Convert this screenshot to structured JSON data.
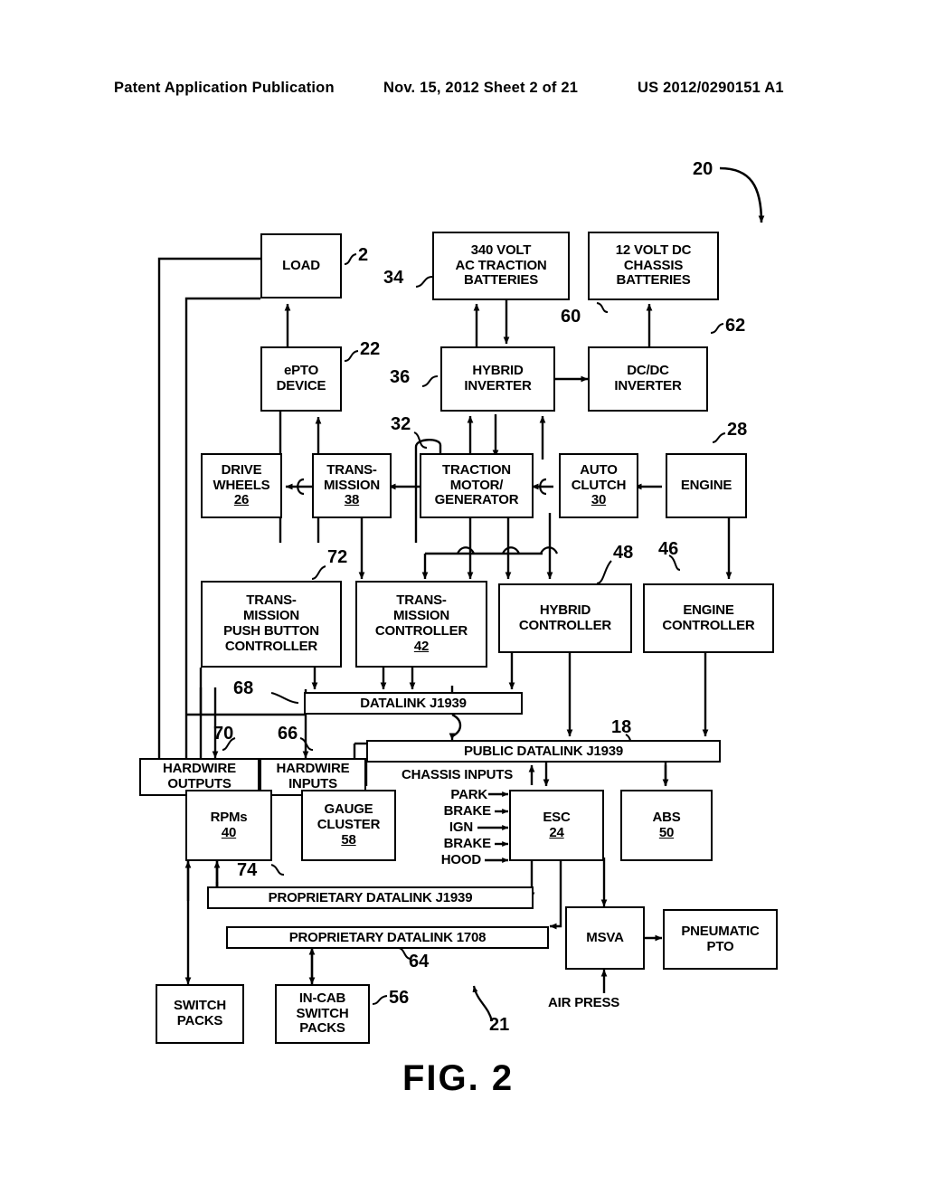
{
  "header": {
    "publication": "Patent Application Publication",
    "date_sheet": "Nov. 15, 2012  Sheet 2 of 21",
    "patent_number": "US 2012/0290151 A1"
  },
  "figure": {
    "label": "FIG.  2"
  },
  "boxes": {
    "load": {
      "lines": [
        "LOAD"
      ]
    },
    "ac_batteries": {
      "lines": [
        "340 VOLT",
        "AC TRACTION",
        "BATTERIES"
      ]
    },
    "dc_batteries": {
      "lines": [
        "12 VOLT DC",
        "CHASSIS",
        "BATTERIES"
      ]
    },
    "epto": {
      "lines": [
        "ePTO",
        "DEVICE"
      ]
    },
    "hybrid_inverter": {
      "lines": [
        "HYBRID",
        "INVERTER"
      ]
    },
    "dcdc_inverter": {
      "lines": [
        "DC/DC",
        "INVERTER"
      ]
    },
    "drive_wheels": {
      "lines": [
        "DRIVE",
        "WHEELS"
      ],
      "num": "26"
    },
    "transmission": {
      "lines": [
        "TRANS-",
        "MISSION"
      ],
      "num": "38"
    },
    "traction_motor": {
      "lines": [
        "TRACTION",
        "MOTOR/",
        "GENERATOR"
      ]
    },
    "auto_clutch": {
      "lines": [
        "AUTO",
        "CLUTCH"
      ],
      "num": "30"
    },
    "engine": {
      "lines": [
        "ENGINE"
      ]
    },
    "tpb_controller": {
      "lines": [
        "TRANS-",
        "MISSION",
        "PUSH BUTTON",
        "CONTROLLER"
      ]
    },
    "trans_controller": {
      "lines": [
        "TRANS-",
        "MISSION",
        "CONTROLLER"
      ],
      "num": "42"
    },
    "hybrid_controller": {
      "lines": [
        "HYBRID",
        "CONTROLLER"
      ]
    },
    "engine_controller": {
      "lines": [
        "ENGINE",
        "CONTROLLER"
      ]
    },
    "hardwire_outputs": {
      "lines": [
        "HARDWIRE",
        "OUTPUTS"
      ]
    },
    "hardwire_inputs": {
      "lines": [
        "HARDWIRE",
        "INPUTS"
      ]
    },
    "rpms": {
      "lines": [
        "RPMs"
      ],
      "num": "40"
    },
    "gauge_cluster": {
      "lines": [
        "GAUGE",
        "CLUSTER"
      ],
      "num": "58"
    },
    "esc": {
      "lines": [
        "ESC"
      ],
      "num": "24"
    },
    "abs": {
      "lines": [
        "ABS"
      ],
      "num": "50"
    },
    "msva": {
      "lines": [
        "MSVA"
      ]
    },
    "pneumatic_pto": {
      "lines": [
        "PNEUMATIC",
        "PTO"
      ]
    },
    "switch_packs": {
      "lines": [
        "SWITCH",
        "PACKS"
      ]
    },
    "incab_switch": {
      "lines": [
        "IN-CAB",
        "SWITCH",
        "PACKS"
      ]
    }
  },
  "bars": {
    "datalink_j1939": "DATALINK J1939",
    "public_datalink": "PUBLIC DATALINK J1939",
    "proprietary_j1939": "PROPRIETARY DATALINK J1939",
    "proprietary_1708": "PROPRIETARY DATALINK 1708"
  },
  "labels": {
    "chassis_inputs": "CHASSIS INPUTS",
    "park": "PARK",
    "brake1": "BRAKE",
    "ign": "IGN",
    "brake2": "BRAKE",
    "hood": "HOOD",
    "air_press": "AIR PRESS"
  },
  "refs": {
    "r20": "20",
    "r2": "2",
    "r34": "34",
    "r60": "60",
    "r62": "62",
    "r22": "22",
    "r36": "36",
    "r32": "32",
    "r28": "28",
    "r72": "72",
    "r48": "48",
    "r46": "46",
    "r68": "68",
    "r18": "18",
    "r70": "70",
    "r66": "66",
    "r74": "74",
    "r64": "64",
    "r56": "56",
    "r21": "21"
  }
}
